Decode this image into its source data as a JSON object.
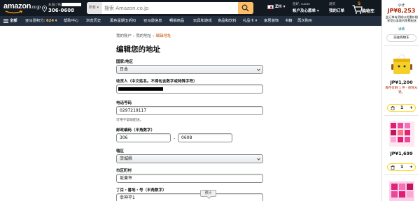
{
  "header": {
    "logo_text": "amazon",
    "logo_tld": ".co.jp",
    "deliver_label": "お届け先",
    "deliver_postcode": "306-0608",
    "search_category": "所有",
    "search_placeholder": "搜索 Amazon.co.jp",
    "language": "ZH",
    "account_greeting": "您好, susan",
    "account_menu": "帐户及心愿单",
    "orders_line1": "退货",
    "orders_line2": "我的订单",
    "cart_count": "5",
    "cart_label": "购物车"
  },
  "subnav": {
    "all": "全部",
    "points_label": "亚马逊积分:",
    "points_value": "624",
    "items": [
      "帮助中心",
      "浏览历史",
      "黑色星期五折扣",
      "亚马逊信息",
      "畅销商品",
      "玩具和游戏",
      "食品和饮料",
      "礼品卡",
      "家居装饰",
      "书籍",
      "再次购买"
    ]
  },
  "breadcrumb": {
    "account": "我的账户",
    "addresses": "我的地址",
    "current": "编辑地址"
  },
  "form": {
    "title": "编辑您的地址",
    "country_label": "国家/地区",
    "country_value": "日本",
    "name_label": "收货人（中文姓名。不得包含数字或特殊字符）",
    "phone_label": "电话号码",
    "phone_value": "0297219117",
    "phone_hint": "可用于帮助配送。",
    "postal_label": "邮政编码（半角数字）",
    "postal_first": "306",
    "postal_dash": "-",
    "postal_second": "0608",
    "prefecture_label": "辖区",
    "prefecture_value": "茨城県",
    "city_label": "市区町村",
    "city_value": "坂東市",
    "street_label": "丁目・番地・号（半角数字）",
    "street_value": "幸神平1"
  },
  "tooltip": "照片",
  "sidebar": {
    "subtotal_label": "小计",
    "subtotal_value": "JP¥8,253",
    "note": "此订单有资格以优惠价格享受日本境内免费配送",
    "details_link": "详情",
    "go_to_cart": "前往购物车",
    "items": [
      {
        "price": "JP¥1,200",
        "stock": "库存仅剩 1 件 - 欲购从速。",
        "qty": "1"
      },
      {
        "price": "JP¥1,699",
        "stock": "",
        "qty": "1"
      }
    ]
  },
  "colors": {
    "nav_dark": "#131921",
    "nav_sub": "#232f3e",
    "accent_orange": "#f08804",
    "search_button": "#febd69",
    "breadcrumb_current": "#c45500",
    "price_red": "#b12704",
    "qty_border": "#ffd814"
  }
}
